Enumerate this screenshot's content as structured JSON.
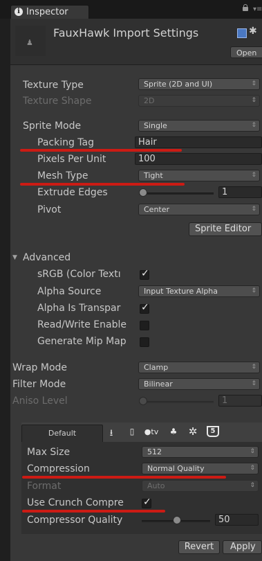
{
  "tab": {
    "label": "Inspector",
    "info_icon": "i"
  },
  "header": {
    "title": "FauxHawk Import Settings",
    "open_label": "Open"
  },
  "fields": {
    "texture_type": {
      "label": "Texture Type",
      "value": "Sprite (2D and UI)"
    },
    "texture_shape": {
      "label": "Texture Shape",
      "value": "2D"
    },
    "sprite_mode": {
      "label": "Sprite Mode",
      "value": "Single"
    },
    "packing_tag": {
      "label": "Packing Tag",
      "value": "Hair"
    },
    "pixels_per_unit": {
      "label": "Pixels Per Unit",
      "value": "100"
    },
    "mesh_type": {
      "label": "Mesh Type",
      "value": "Tight"
    },
    "extrude_edges": {
      "label": "Extrude Edges",
      "value": "1",
      "level": 0.0
    },
    "pivot": {
      "label": "Pivot",
      "value": "Center"
    },
    "sprite_editor_label": "Sprite Editor"
  },
  "advanced": {
    "label": "Advanced",
    "srgb": {
      "label": "sRGB (Color Textı",
      "checked": true
    },
    "alpha_source": {
      "label": "Alpha Source",
      "value": "Input Texture Alpha"
    },
    "alpha_transparency": {
      "label": "Alpha Is Transpar",
      "checked": true
    },
    "read_write": {
      "label": "Read/Write Enable",
      "checked": false
    },
    "mip_maps": {
      "label": "Generate Mip Map",
      "checked": false
    }
  },
  "wrap": {
    "wrap_mode": {
      "label": "Wrap Mode",
      "value": "Clamp"
    },
    "filter_mode": {
      "label": "Filter Mode",
      "value": "Bilinear"
    },
    "aniso_level": {
      "label": "Aniso Level",
      "value": "1",
      "level": 0.0
    }
  },
  "platform": {
    "default_tab": "Default",
    "tab_icons": [
      "download-icon",
      "phone-icon",
      "appletv-icon",
      "android-icon",
      "webgl-icon",
      "html5-icon"
    ],
    "tv_label": "tv",
    "html5_label": "5",
    "max_size": {
      "label": "Max Size",
      "value": "512"
    },
    "compression": {
      "label": "Compression",
      "value": "Normal Quality"
    },
    "format": {
      "label": "Format",
      "value": "Auto"
    },
    "crunch": {
      "label": "Use Crunch Compre",
      "checked": true
    },
    "compressor_quality": {
      "label": "Compressor Quality",
      "value": "50",
      "level": 0.5
    }
  },
  "buttons": {
    "revert_label": "Revert",
    "apply_label": "Apply"
  },
  "colors": {
    "highlight_underline": "#cc1b14",
    "panel_bg": "#383838"
  }
}
